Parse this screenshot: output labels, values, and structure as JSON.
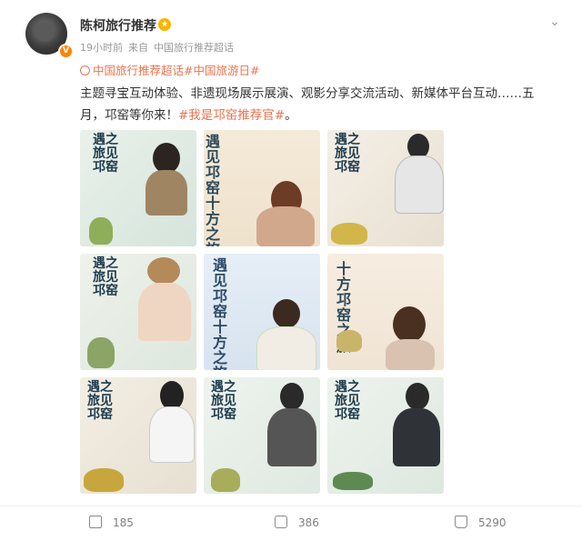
{
  "post": {
    "author": "陈柯旅行推荐",
    "time": "19小时前",
    "source_prefix": "来自",
    "source": "中国旅行推荐超话",
    "topics": "中国旅行推荐超话#中国旅游日#",
    "text_main": "主题寻宝互动体验、非遗现场展示展演、观影分享交流活动、新媒体平台互动……五月，邛窑等你来！",
    "text_tag": "#我是邛窑推荐官#",
    "text_end": "。"
  },
  "images": {
    "title_a": "遇之旅见邛窑",
    "title_b": "遇见邛窑十方之旅",
    "title_c": "十方邛窑之旅"
  },
  "footer": {
    "share_count": "185",
    "comment_count": "386",
    "like_count": "5290"
  },
  "colors": {
    "accent": "#eb7350",
    "muted": "#999999",
    "text": "#333333"
  }
}
